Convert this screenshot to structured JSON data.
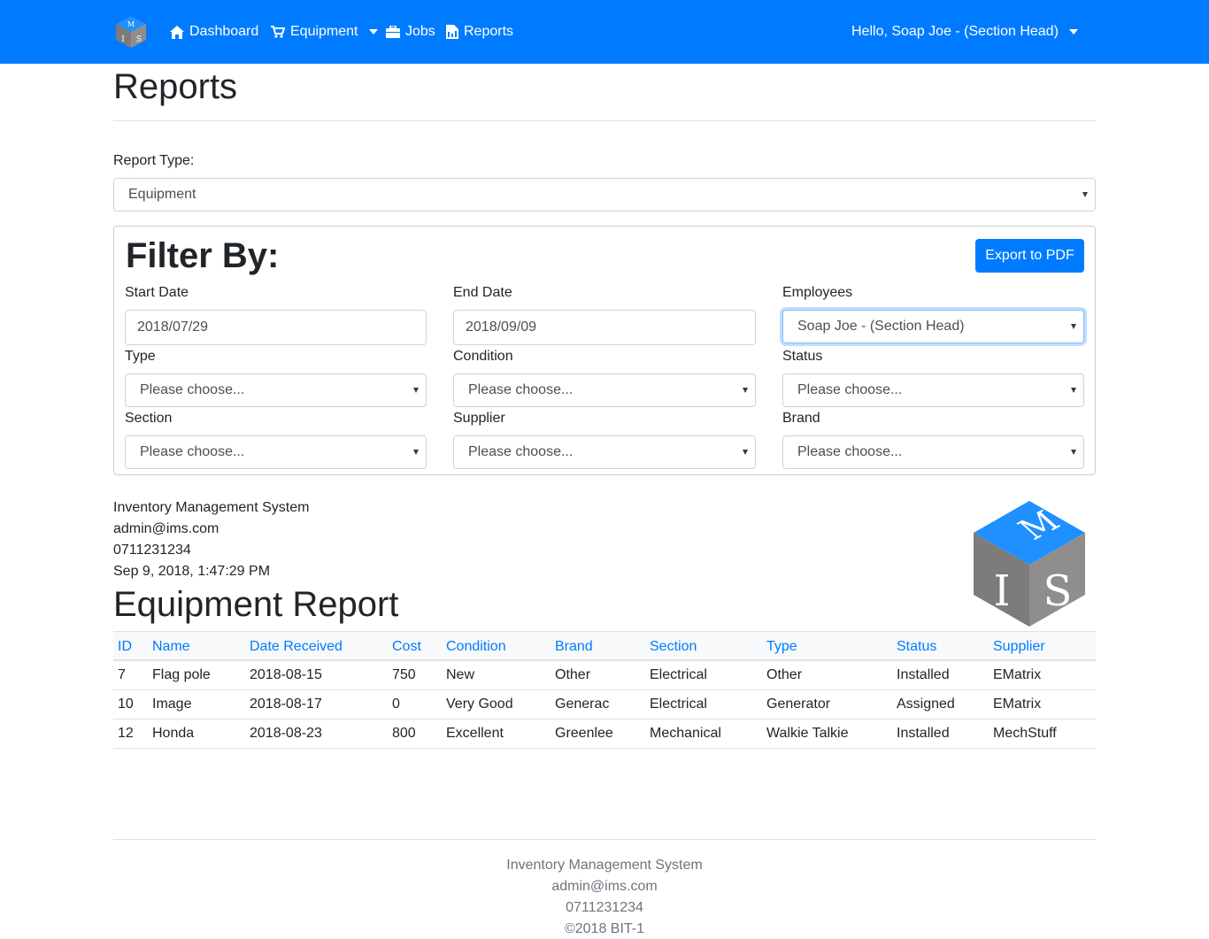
{
  "navbar": {
    "brand_letters": [
      "M",
      "I",
      "S"
    ],
    "items": [
      {
        "label": "Dashboard",
        "icon": "home-icon"
      },
      {
        "label": "Equipment",
        "icon": "cart-icon"
      },
      {
        "label": "Jobs",
        "icon": "briefcase-icon"
      },
      {
        "label": "Reports",
        "icon": "report-file-icon"
      }
    ],
    "user_greeting": "Hello, Soap Joe - (Section Head)"
  },
  "page": {
    "title": "Reports"
  },
  "report_type": {
    "label": "Report Type:",
    "value": "Equipment"
  },
  "filter": {
    "title": "Filter By:",
    "export_label": "Export to PDF",
    "start_date": {
      "label": "Start Date",
      "value": "2018/07/29"
    },
    "end_date": {
      "label": "End Date",
      "value": "2018/09/09"
    },
    "employees": {
      "label": "Employees",
      "value": "Soap Joe - (Section Head)"
    },
    "type": {
      "label": "Type",
      "value": "Please choose..."
    },
    "condition": {
      "label": "Condition",
      "value": "Please choose..."
    },
    "status": {
      "label": "Status",
      "value": "Please choose..."
    },
    "section": {
      "label": "Section",
      "value": "Please choose..."
    },
    "supplier": {
      "label": "Supplier",
      "value": "Please choose..."
    },
    "brand": {
      "label": "Brand",
      "value": "Please choose..."
    }
  },
  "report_header": {
    "company": "Inventory Management System",
    "email": "admin@ims.com",
    "phone": "0711231234",
    "generated": "Sep 9, 2018, 1:47:29 PM",
    "title": "Equipment Report",
    "logo_letters": [
      "M",
      "I",
      "S"
    ]
  },
  "table": {
    "columns": [
      "ID",
      "Name",
      "Date Received",
      "Cost",
      "Condition",
      "Brand",
      "Section",
      "Type",
      "Status",
      "Supplier"
    ],
    "rows": [
      [
        "7",
        "Flag pole",
        "2018-08-15",
        "750",
        "New",
        "Other",
        "Electrical",
        "Other",
        "Installed",
        "EMatrix"
      ],
      [
        "10",
        "Image",
        "2018-08-17",
        "0",
        "Very Good",
        "Generac",
        "Electrical",
        "Generator",
        "Assigned",
        "EMatrix"
      ],
      [
        "12",
        "Honda",
        "2018-08-23",
        "800",
        "Excellent",
        "Greenlee",
        "Mechanical",
        "Walkie Talkie",
        "Installed",
        "MechStuff"
      ]
    ]
  },
  "footer": {
    "company": "Inventory Management System",
    "email": "admin@ims.com",
    "phone": "0711231234",
    "copyright": "©2018 BIT-1"
  },
  "colors": {
    "primary": "#007bff",
    "cube_top": "#1e90ff",
    "cube_side": "#7d7c7b"
  }
}
